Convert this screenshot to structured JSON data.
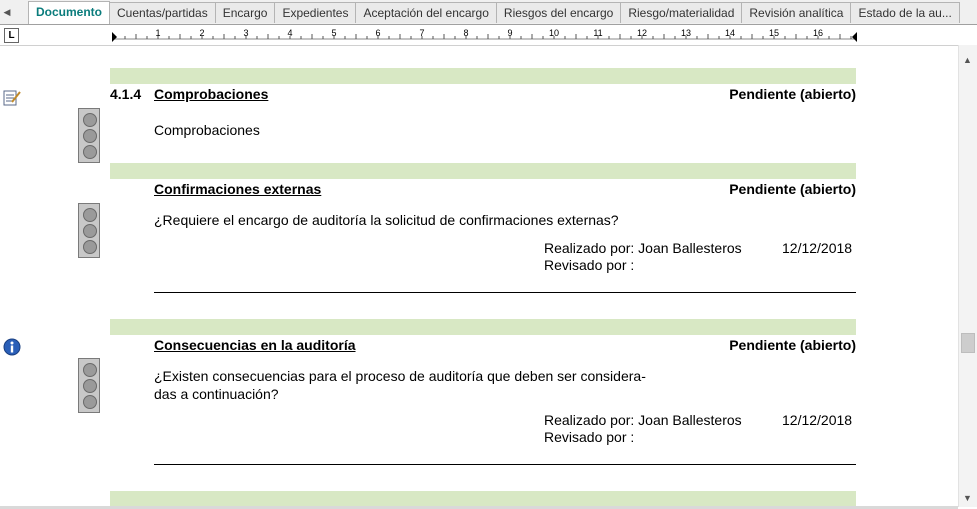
{
  "tabs": [
    {
      "label": "Documento",
      "active": true
    },
    {
      "label": "Cuentas/partidas"
    },
    {
      "label": "Encargo"
    },
    {
      "label": "Expedientes"
    },
    {
      "label": "Aceptación del encargo"
    },
    {
      "label": "Riesgos del encargo"
    },
    {
      "label": "Riesgo/materialidad"
    },
    {
      "label": "Revisión analítica"
    },
    {
      "label": "Estado de la au..."
    }
  ],
  "ruler": {
    "corner_label": "L",
    "numbers": [
      "1",
      "2",
      "3",
      "4",
      "5",
      "6",
      "7",
      "8",
      "9",
      "10",
      "11",
      "12",
      "13",
      "14",
      "15",
      "16"
    ]
  },
  "sections": [
    {
      "number": "4.1.4",
      "title": "Comprobaciones",
      "status": "Pendiente (abierto)",
      "text": "Comprobaciones"
    },
    {
      "title": "Confirmaciones externas",
      "status": "Pendiente (abierto)",
      "question": "¿Requiere el encargo de auditoría la solicitud de confirmaciones externas?",
      "realizado": "Realizado por: Joan Ballesteros",
      "fecha": "12/12/2018",
      "revisado": "Revisado por :"
    },
    {
      "title": "Consecuencias en la auditoría",
      "status": "Pendiente (abierto)",
      "question_line1": "¿Existen consecuencias para el proceso de auditoría que deben ser considera-",
      "question_line2": "das a continuación?",
      "realizado": "Realizado por: Joan Ballesteros",
      "fecha": "12/12/2018",
      "revisado": "Revisado por :"
    }
  ],
  "icons": {
    "edit": "edit-note-icon",
    "info": "info-icon",
    "traffic": "traffic-light-icon"
  },
  "colors": {
    "band": "#d8e8c4",
    "active_tab": "#0a7c7c"
  }
}
